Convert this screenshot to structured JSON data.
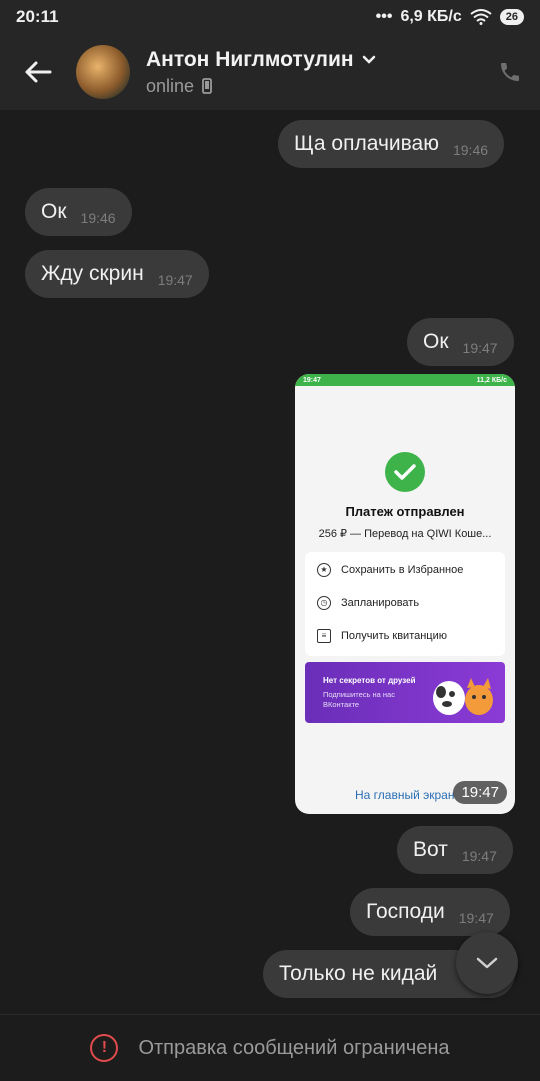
{
  "status_bar": {
    "time": "20:11",
    "network_speed": "6,9 КБ/с",
    "battery": "26"
  },
  "header": {
    "contact_name": "Антон Ниглмотулин",
    "presence": "online"
  },
  "messages": [
    {
      "text": "Ща оплачиваю",
      "time": "19:46",
      "direction": "outgoing"
    },
    {
      "text": "Ок",
      "time": "19:46",
      "direction": "incoming"
    },
    {
      "text": "Жду скрин",
      "time": "19:47",
      "direction": "incoming"
    },
    {
      "text": "Ок",
      "time": "19:47",
      "direction": "outgoing"
    },
    {
      "text": "Вот",
      "time": "19:47",
      "direction": "outgoing"
    },
    {
      "text": "Господи",
      "time": "19:47",
      "direction": "outgoing"
    },
    {
      "text": "Только не кидай",
      "time": "",
      "direction": "outgoing"
    }
  ],
  "screenshot": {
    "status_time": "19:47",
    "status_speed": "11,2 КБ/с",
    "title": "Платеж отправлен",
    "subtitle": "256 ₽ — Перевод на QIWI Коше...",
    "actions": [
      "Сохранить в Избранное",
      "Запланировать",
      "Получить квитанцию"
    ],
    "promo_title": "Нет секретов от друзей",
    "promo_text": "Подпишитесь на нас ВКонтакте",
    "home_link": "На главный экран",
    "time": "19:47"
  },
  "footer": {
    "notice": "Отправка сообщений ограничена"
  }
}
